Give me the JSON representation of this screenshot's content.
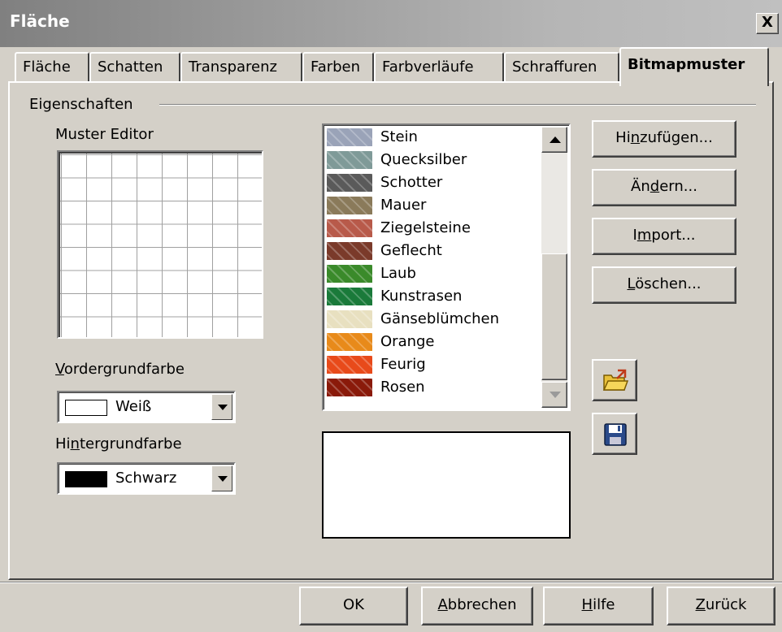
{
  "window": {
    "title": "Fläche",
    "close_label": "X"
  },
  "tabs": [
    {
      "label": "Fläche",
      "active": false
    },
    {
      "label": "Schatten",
      "active": false
    },
    {
      "label": "Transparenz",
      "active": false
    },
    {
      "label": "Farben",
      "active": false
    },
    {
      "label": "Farbverläufe",
      "active": false
    },
    {
      "label": "Schraffuren",
      "active": false
    },
    {
      "label": "Bitmapmuster",
      "active": true
    }
  ],
  "properties": {
    "group_title": "Eigenschaften",
    "editor_label": "Muster Editor",
    "foreground_label": "Vordergrundfarbe",
    "foreground_value": "Weiß",
    "foreground_swatch": "#ffffff",
    "background_label": "Hintergrundfarbe",
    "background_value": "Schwarz",
    "background_swatch": "#000000"
  },
  "bitmap_list": [
    {
      "label": "Stein",
      "icon": "stone-texture",
      "color": "#9aa3b8"
    },
    {
      "label": "Quecksilber",
      "icon": "mercury-texture",
      "color": "#7f9a98"
    },
    {
      "label": "Schotter",
      "icon": "gravel-texture",
      "color": "#5a5a5a"
    },
    {
      "label": "Mauer",
      "icon": "wall-texture",
      "color": "#8a7a5a"
    },
    {
      "label": "Ziegelsteine",
      "icon": "bricks-texture",
      "color": "#b85a4a"
    },
    {
      "label": "Geflecht",
      "icon": "weave-texture",
      "color": "#7a3a2a"
    },
    {
      "label": "Laub",
      "icon": "foliage-texture",
      "color": "#3a8a2a"
    },
    {
      "label": "Kunstrasen",
      "icon": "artificial-turf-texture",
      "color": "#1a7a3a"
    },
    {
      "label": "Gänseblümchen",
      "icon": "daisies-texture",
      "color": "#e8e0c0"
    },
    {
      "label": "Orange",
      "icon": "orange-texture",
      "color": "#e88a1a"
    },
    {
      "label": "Feurig",
      "icon": "fiery-texture",
      "color": "#e84a1a"
    },
    {
      "label": "Rosen",
      "icon": "roses-texture",
      "color": "#8a1a0a"
    }
  ],
  "actions": {
    "add": {
      "pre": "Hi",
      "key": "n",
      "post": "zufügen..."
    },
    "modify": {
      "pre": "Än",
      "key": "d",
      "post": "ern..."
    },
    "import": {
      "pre": "I",
      "key": "m",
      "post": "port..."
    },
    "delete": {
      "pre": "",
      "key": "L",
      "post": "öschen..."
    }
  },
  "icons": {
    "open": "open-folder-icon",
    "save": "save-disk-icon"
  },
  "footer": {
    "ok": "OK",
    "cancel": {
      "pre": "",
      "key": "A",
      "post": "bbrechen"
    },
    "help": {
      "pre": "",
      "key": "H",
      "post": "ilfe"
    },
    "reset": {
      "pre": "",
      "key": "Z",
      "post": "urück"
    }
  }
}
